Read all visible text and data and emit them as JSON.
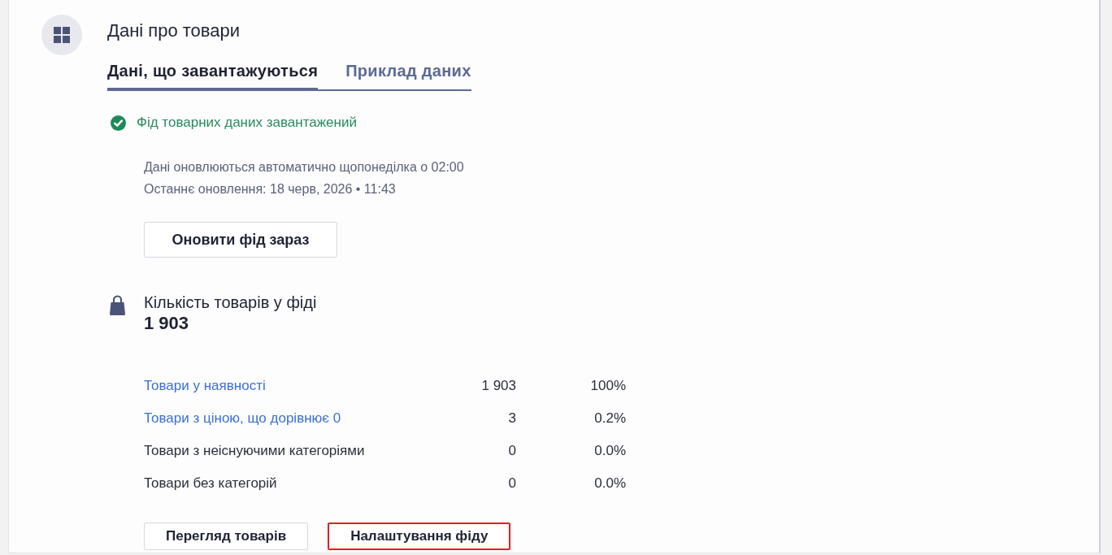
{
  "section": {
    "title": "Дані про товари"
  },
  "tabs": [
    {
      "label": "Дані, що завантажуються",
      "selected": true
    },
    {
      "label": "Приклад даних",
      "selected": false
    }
  ],
  "status": {
    "kind": "success",
    "text": "Фід товарних даних завантажений"
  },
  "schedule": [
    "Дані оновлюються автоматично щопонеділка о 02:00",
    "Останнє оновлення: 18 черв, 2026 • 11:43"
  ],
  "refresh_button": {
    "label": "Оновити фід зараз"
  },
  "product_count": {
    "label": "Кількість товарів у фіді",
    "value": "1 903"
  },
  "breakdown": [
    {
      "kind": "link",
      "label": "Товари у наявності",
      "count": "1 903",
      "share": "100%"
    },
    {
      "kind": "link",
      "label": "Товари з ціною, що дорівнює 0",
      "count": "3",
      "share": "0.2%"
    },
    {
      "kind": "text",
      "label": "Товари з неіснуючими категоріями",
      "count": "0",
      "share": "0.0%"
    },
    {
      "kind": "text",
      "label": "Товари без категорій",
      "count": "0",
      "share": "0.0%"
    }
  ],
  "actions": [
    {
      "label": "Перегляд товарів",
      "highlighted": false
    },
    {
      "label": "Налаштування фіду",
      "highlighted": true
    }
  ]
}
